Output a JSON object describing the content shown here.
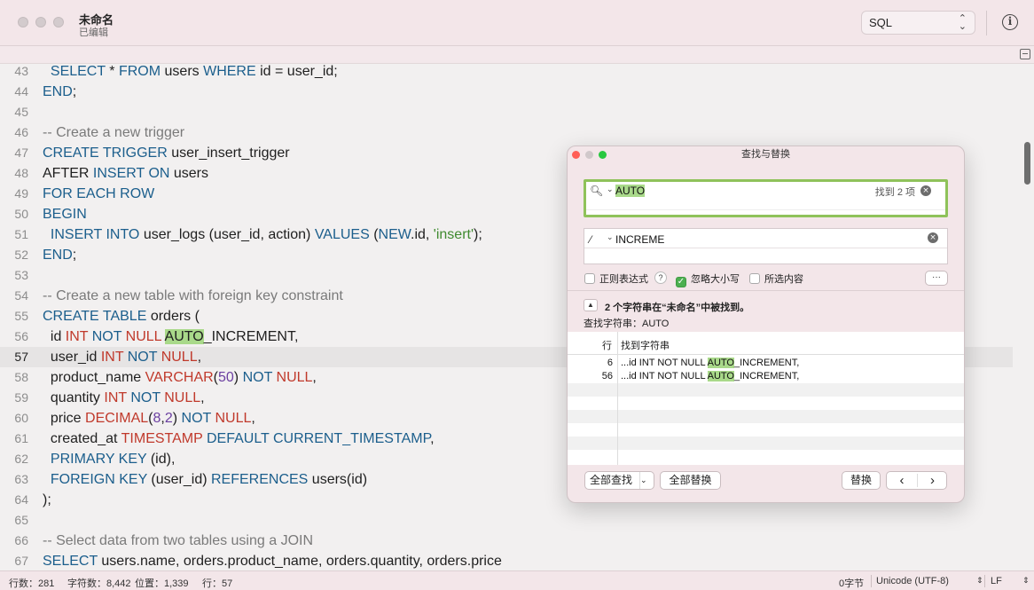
{
  "window": {
    "title": "未命名",
    "subtitle": "已编辑"
  },
  "toolbar": {
    "language": "SQL",
    "info_glyph": "i"
  },
  "editor": {
    "lines": [
      {
        "no": "43",
        "tokens": [
          {
            "t": "  "
          },
          {
            "t": "SELECT",
            "c": "kw"
          },
          {
            "t": " * "
          },
          {
            "t": "FROM",
            "c": "kw"
          },
          {
            "t": " users "
          },
          {
            "t": "WHERE",
            "c": "kw"
          },
          {
            "t": " id = user_id;"
          }
        ]
      },
      {
        "no": "44",
        "tokens": [
          {
            "t": "END",
            "c": "kw"
          },
          {
            "t": ";"
          }
        ]
      },
      {
        "no": "45",
        "tokens": []
      },
      {
        "no": "46",
        "tokens": [
          {
            "t": "-- Create a new trigger",
            "c": "cm"
          }
        ]
      },
      {
        "no": "47",
        "tokens": [
          {
            "t": "CREATE",
            "c": "kw"
          },
          {
            "t": " "
          },
          {
            "t": "TRIGGER",
            "c": "kw"
          },
          {
            "t": " user_insert_trigger"
          }
        ]
      },
      {
        "no": "48",
        "tokens": [
          {
            "t": "AFTER "
          },
          {
            "t": "INSERT",
            "c": "kw"
          },
          {
            "t": " "
          },
          {
            "t": "ON",
            "c": "kw"
          },
          {
            "t": " users"
          }
        ]
      },
      {
        "no": "49",
        "tokens": [
          {
            "t": "FOR",
            "c": "kw"
          },
          {
            "t": " "
          },
          {
            "t": "EACH",
            "c": "kw"
          },
          {
            "t": " "
          },
          {
            "t": "ROW",
            "c": "kw"
          }
        ]
      },
      {
        "no": "50",
        "tokens": [
          {
            "t": "BEGIN",
            "c": "kw"
          }
        ]
      },
      {
        "no": "51",
        "tokens": [
          {
            "t": "  "
          },
          {
            "t": "INSERT",
            "c": "kw"
          },
          {
            "t": " "
          },
          {
            "t": "INTO",
            "c": "kw"
          },
          {
            "t": " user_logs (user_id, action) "
          },
          {
            "t": "VALUES",
            "c": "kw"
          },
          {
            "t": " ("
          },
          {
            "t": "NEW",
            "c": "kw"
          },
          {
            "t": ".id, "
          },
          {
            "t": "'insert'",
            "c": "st"
          },
          {
            "t": ");"
          }
        ]
      },
      {
        "no": "52",
        "tokens": [
          {
            "t": "END",
            "c": "kw"
          },
          {
            "t": ";"
          }
        ]
      },
      {
        "no": "53",
        "tokens": []
      },
      {
        "no": "54",
        "tokens": [
          {
            "t": "-- Create a new table with foreign key constraint",
            "c": "cm"
          }
        ]
      },
      {
        "no": "55",
        "tokens": [
          {
            "t": "CREATE",
            "c": "kw"
          },
          {
            "t": " "
          },
          {
            "t": "TABLE",
            "c": "kw"
          },
          {
            "t": " orders ("
          }
        ]
      },
      {
        "no": "56",
        "tokens": [
          {
            "t": "  id "
          },
          {
            "t": "INT",
            "c": "ty"
          },
          {
            "t": " "
          },
          {
            "t": "NOT",
            "c": "kw"
          },
          {
            "t": " "
          },
          {
            "t": "NULL",
            "c": "ty"
          },
          {
            "t": " "
          },
          {
            "t": "AUTO",
            "c": "hl"
          },
          {
            "t": "_INCREMENT,"
          }
        ]
      },
      {
        "no": "57",
        "current": true,
        "tokens": [
          {
            "t": "  user_id "
          },
          {
            "t": "INT",
            "c": "ty"
          },
          {
            "t": " "
          },
          {
            "t": "NOT",
            "c": "kw"
          },
          {
            "t": " "
          },
          {
            "t": "NULL",
            "c": "ty"
          },
          {
            "t": ","
          }
        ]
      },
      {
        "no": "58",
        "tokens": [
          {
            "t": "  product_name "
          },
          {
            "t": "VARCHAR",
            "c": "ty"
          },
          {
            "t": "("
          },
          {
            "t": "50",
            "c": "nm"
          },
          {
            "t": ") "
          },
          {
            "t": "NOT",
            "c": "kw"
          },
          {
            "t": " "
          },
          {
            "t": "NULL",
            "c": "ty"
          },
          {
            "t": ","
          }
        ]
      },
      {
        "no": "59",
        "tokens": [
          {
            "t": "  quantity "
          },
          {
            "t": "INT",
            "c": "ty"
          },
          {
            "t": " "
          },
          {
            "t": "NOT",
            "c": "kw"
          },
          {
            "t": " "
          },
          {
            "t": "NULL",
            "c": "ty"
          },
          {
            "t": ","
          }
        ]
      },
      {
        "no": "60",
        "tokens": [
          {
            "t": "  price "
          },
          {
            "t": "DECIMAL",
            "c": "ty"
          },
          {
            "t": "("
          },
          {
            "t": "8",
            "c": "nm"
          },
          {
            "t": ","
          },
          {
            "t": "2",
            "c": "nm"
          },
          {
            "t": ") "
          },
          {
            "t": "NOT",
            "c": "kw"
          },
          {
            "t": " "
          },
          {
            "t": "NULL",
            "c": "ty"
          },
          {
            "t": ","
          }
        ]
      },
      {
        "no": "61",
        "tokens": [
          {
            "t": "  created_at "
          },
          {
            "t": "TIMESTAMP",
            "c": "ty"
          },
          {
            "t": " "
          },
          {
            "t": "DEFAULT",
            "c": "kw"
          },
          {
            "t": " "
          },
          {
            "t": "CURRENT_TIMESTAMP",
            "c": "kw"
          },
          {
            "t": ","
          }
        ]
      },
      {
        "no": "62",
        "tokens": [
          {
            "t": "  "
          },
          {
            "t": "PRIMARY",
            "c": "kw"
          },
          {
            "t": " "
          },
          {
            "t": "KEY",
            "c": "kw"
          },
          {
            "t": " (id),"
          }
        ]
      },
      {
        "no": "63",
        "tokens": [
          {
            "t": "  "
          },
          {
            "t": "FOREIGN",
            "c": "kw"
          },
          {
            "t": " "
          },
          {
            "t": "KEY",
            "c": "kw"
          },
          {
            "t": " (user_id) "
          },
          {
            "t": "REFERENCES",
            "c": "kw"
          },
          {
            "t": " users(id)"
          }
        ]
      },
      {
        "no": "64",
        "tokens": [
          {
            "t": ");"
          }
        ]
      },
      {
        "no": "65",
        "tokens": []
      },
      {
        "no": "66",
        "tokens": [
          {
            "t": "-- Select data from two tables using a JOIN",
            "c": "cm"
          }
        ]
      },
      {
        "no": "67",
        "tokens": [
          {
            "t": "SELECT",
            "c": "kw"
          },
          {
            "t": " users.name, orders.product_name, orders.quantity, orders.price"
          }
        ]
      }
    ]
  },
  "status": {
    "lines": "行数：281",
    "chars": "字符数：8,442",
    "position": "位置：1,339",
    "row": "行：57",
    "bytes": "0字节",
    "encoding": "Unicode (UTF-8)",
    "line_ending": "LF"
  },
  "find_dialog": {
    "title": "查找与替换",
    "find_value": "AUTO",
    "find_count": "找到 2 项",
    "replace_value": "INCREME",
    "options": {
      "regex": "正则表达式",
      "help": "?",
      "ignore_case": "忽略大小写",
      "selection": "所选内容",
      "more": "···"
    },
    "summary": "2 个字符串在“未命名”中被找到。",
    "search_string": "查找字符串：AUTO",
    "columns": {
      "line": "行",
      "found": "找到字符串"
    },
    "results": [
      {
        "line": "6",
        "before": "...id INT NOT NULL ",
        "match": "AUTO",
        "after": "_INCREMENT,"
      },
      {
        "line": "56",
        "before": "...id INT NOT NULL ",
        "match": "AUTO",
        "after": "_INCREMENT,"
      }
    ],
    "buttons": {
      "find_all": "全部查找",
      "replace_all": "全部替换",
      "replace": "替换",
      "prev": "‹",
      "next": "›"
    }
  },
  "colors": {
    "highlight": "#a9d98a",
    "keyword": "#1b5e8c",
    "type": "#c0392b",
    "accent": "#8fc25a"
  }
}
